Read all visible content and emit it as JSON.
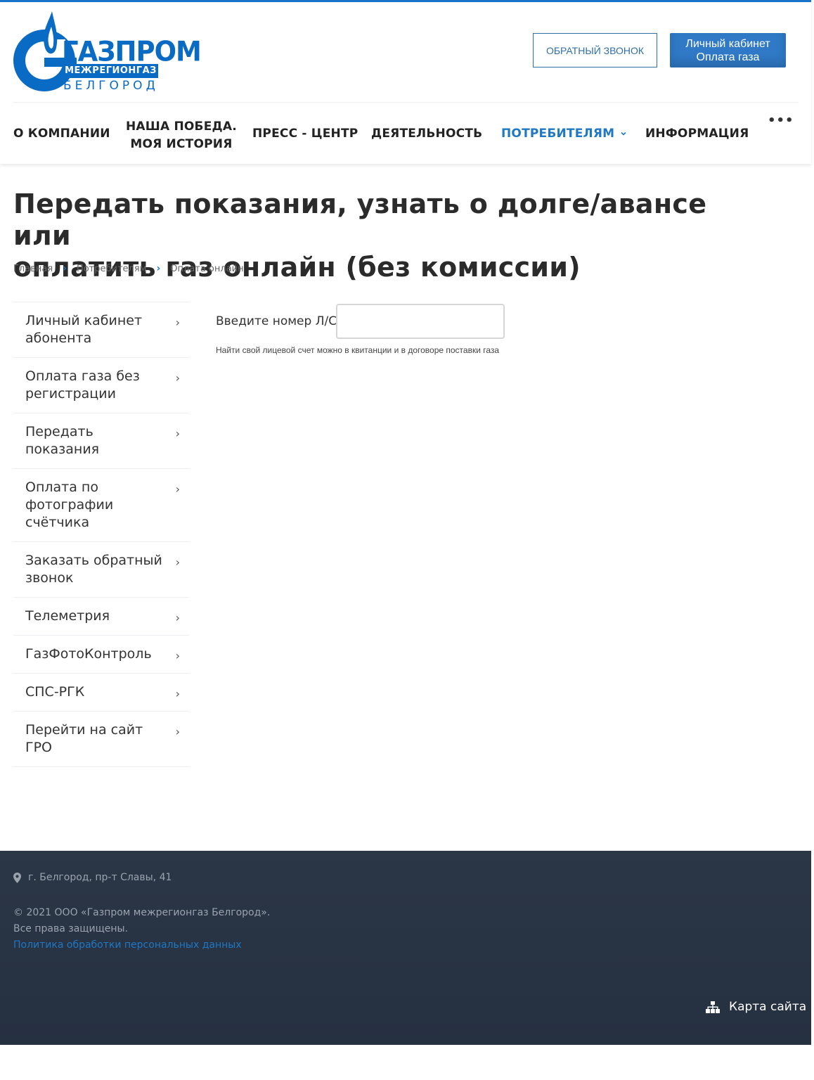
{
  "header": {
    "logo": {
      "brand": "ГАЗПРОМ",
      "sub1": "МЕЖРЕГИОНГАЗ",
      "sub2": "БЕЛГОРОД"
    },
    "callback_button": "ОБРАТНЫЙ ЗВОНОК",
    "cabinet_button": {
      "line1": "Личный кабинет",
      "line2": "Оплата газа"
    },
    "nav": [
      {
        "label": "О КОМПАНИИ"
      },
      {
        "label_line1": "НАША ПОБЕДА.",
        "label_line2": "МОЯ ИСТОРИЯ"
      },
      {
        "label": "ПРЕСС - ЦЕНТР"
      },
      {
        "label": "ДЕЯТЕЛЬНОСТЬ"
      },
      {
        "label": "ПОТРЕБИТЕЛЯМ",
        "active": true
      },
      {
        "label": "ИНФОРМАЦИЯ"
      }
    ],
    "more": "•••"
  },
  "page": {
    "title_line1": "Передать показания, узнать о долге/авансе или",
    "title_line2": "оплатить газ онлайн (без комиссии)",
    "breadcrumb": [
      "Главная",
      "Потребителям",
      "Оплата онлайн"
    ]
  },
  "sidebar": {
    "items": [
      {
        "line1": "Личный кабинет",
        "line2": "абонента"
      },
      {
        "line1": "Оплата газа без",
        "line2": "регистрации"
      },
      {
        "line1": "Передать показания"
      },
      {
        "line1": "Оплата по",
        "line2": "фотографии",
        "line3": "счётчика"
      },
      {
        "line1": "Заказать обратный",
        "line2": "звонок"
      },
      {
        "line1": "Телеметрия"
      },
      {
        "line1": "ГазФотоКонтроль"
      },
      {
        "line1": "СПС-РГК"
      },
      {
        "line1": "Перейти на сайт ГРО"
      }
    ]
  },
  "form": {
    "label": "Введите номер Л/С",
    "value": "",
    "hint": "Найти свой лицевой счет можно в квитанции и в договоре поставки газа"
  },
  "footer": {
    "address": "г. Белгород, пр-т Славы, 41",
    "copyright": "© 2021 ООО «Газпром межрегионгаз Белгород».",
    "rights": "Все права защищены.",
    "policy_link": "Политика обработки персональных данных",
    "sitemap": "Карта сайта"
  },
  "colors": {
    "accent": "#1f78c4",
    "brand": "#0a6bc4",
    "footer_bg": "#2b3646"
  },
  "icons": {
    "location": "map-marker-icon",
    "sitemap": "sitemap-icon",
    "chevron": "chevron-right-icon"
  }
}
